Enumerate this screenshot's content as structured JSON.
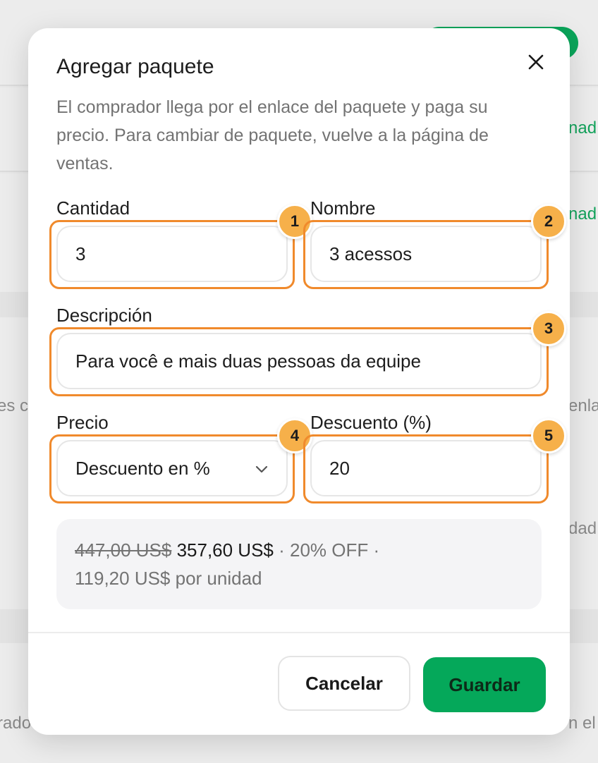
{
  "background": {
    "fragments": [
      "nad",
      "nad",
      "es c",
      "enla",
      "dad",
      "rado",
      "n el"
    ]
  },
  "modal": {
    "title": "Agregar paquete",
    "subtitle": "El comprador llega por el enlace del paquete y paga su precio. Para cambiar de paquete, vuelve a la página de ventas.",
    "close_icon": "close-icon",
    "fields": {
      "quantity": {
        "label": "Cantidad",
        "value": "3",
        "badge": "1"
      },
      "name": {
        "label": "Nombre",
        "value": "3 acessos",
        "badge": "2"
      },
      "description": {
        "label": "Descripción",
        "value": "Para você e mais duas pessoas da equipe",
        "badge": "3"
      },
      "price_type": {
        "label": "Precio",
        "value": "Descuento en %",
        "badge": "4"
      },
      "discount": {
        "label": "Descuento (%)",
        "value": "20",
        "badge": "5"
      }
    },
    "summary": {
      "original_price": "447,00 US$",
      "final_price": "357,60 US$",
      "off_text": "· 20% OFF ·",
      "unit_price": "119,20 US$ por unidad"
    },
    "buttons": {
      "cancel": "Cancelar",
      "save": "Guardar"
    }
  },
  "colors": {
    "accent_green": "#05a85a",
    "highlight_orange": "#f08a2c",
    "badge_orange": "#f6b04a"
  }
}
